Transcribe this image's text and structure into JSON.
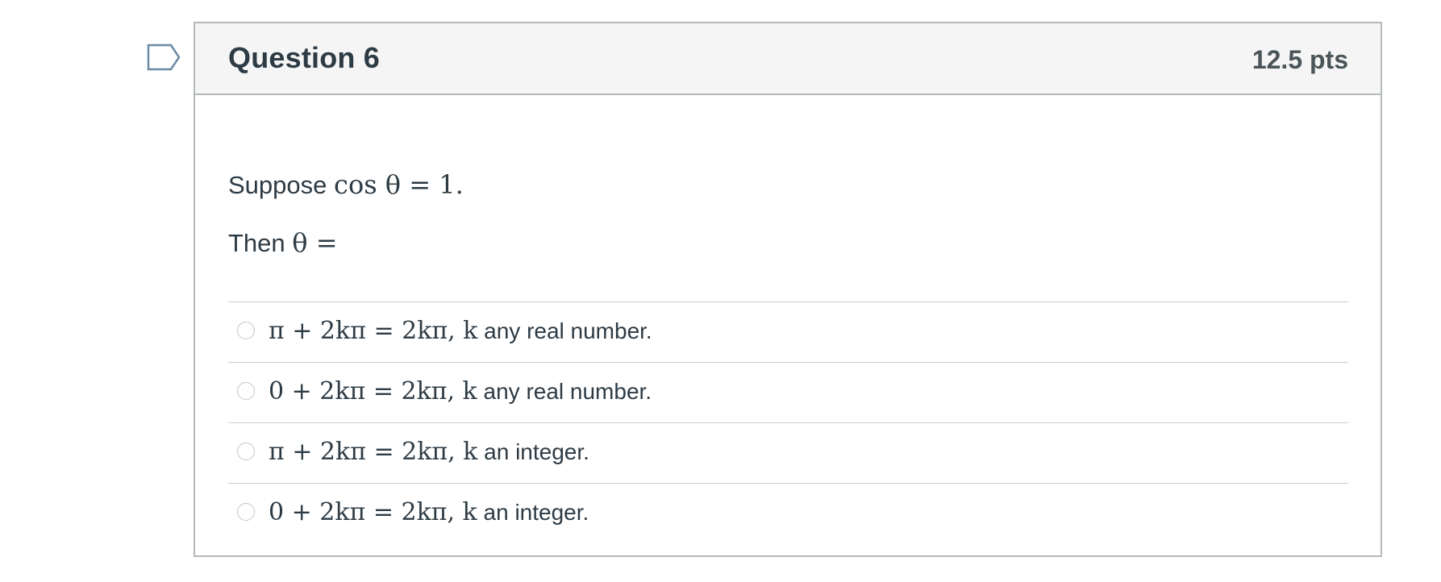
{
  "question": {
    "title": "Question 6",
    "points": "12.5 pts",
    "prompt_prefix": "Suppose",
    "prompt_math": "cos θ = 1.",
    "then_prefix": "Then",
    "then_math": "θ ="
  },
  "answers": [
    {
      "math": "π + 2kπ = 2kπ, k",
      "text": "any real number."
    },
    {
      "math": "0 + 2kπ = 2kπ, k",
      "text": "any real number."
    },
    {
      "math": "π + 2kπ = 2kπ, k",
      "text": "an integer."
    },
    {
      "math": "0 + 2kπ = 2kπ, k",
      "text": "an integer."
    }
  ],
  "icons": {
    "flag": "flag-icon"
  },
  "colors": {
    "header_bg": "#f5f5f5",
    "border": "#b4b9bc",
    "text": "#2d3b45",
    "flag_stroke": "#6b8aa6"
  }
}
